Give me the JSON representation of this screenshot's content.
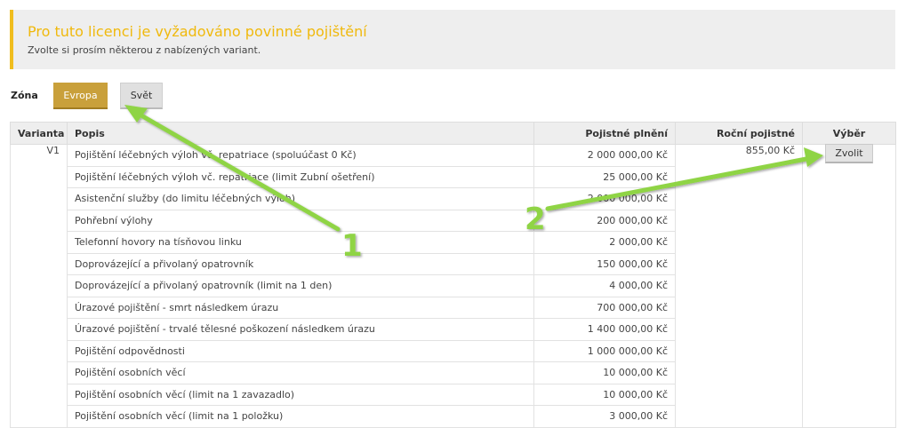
{
  "notice": {
    "title": "Pro tuto licenci je vyžadováno povinné pojištění",
    "text": "Zvolte si prosím některou z nabízených variant."
  },
  "zone": {
    "label": "Zóna",
    "options": [
      {
        "label": "Evropa",
        "active": true
      },
      {
        "label": "Svět",
        "active": false
      }
    ]
  },
  "table": {
    "headers": {
      "variant": "Varianta",
      "description": "Popis",
      "coverage": "Pojistné plnění",
      "premium": "Roční pojistné",
      "select": "Výběr"
    },
    "variant": "V1",
    "premium": "855,00 Kč",
    "select_label": "Zvolit",
    "rows": [
      {
        "desc": "Pojištění léčebných výloh vč. repatriace (spoluúčast 0 Kč)",
        "amount": "2 000 000,00 Kč"
      },
      {
        "desc": "Pojištění léčebných výloh vč. repatriace (limit Zubní ošetření)",
        "amount": "25 000,00 Kč"
      },
      {
        "desc": "Asistenční služby (do limitu léčebných výloh)",
        "amount": "2 000 000,00 Kč"
      },
      {
        "desc": "Pohřební výlohy",
        "amount": "200 000,00 Kč"
      },
      {
        "desc": "Telefonní hovory na tísňovou linku",
        "amount": "2 000,00 Kč"
      },
      {
        "desc": "Doprovázející a přivolaný opatrovník",
        "amount": "150 000,00 Kč"
      },
      {
        "desc": "Doprovázející a přivolaný opatrovník (limit na 1 den)",
        "amount": "4 000,00 Kč"
      },
      {
        "desc": "Úrazové pojištění - smrt následkem úrazu",
        "amount": "700 000,00 Kč"
      },
      {
        "desc": "Úrazové pojištění - trvalé tělesné poškození následkem úrazu",
        "amount": "1 400 000,00 Kč"
      },
      {
        "desc": "Pojištění odpovědnosti",
        "amount": "1 000 000,00 Kč"
      },
      {
        "desc": "Pojištění osobních věcí",
        "amount": "10 000,00 Kč"
      },
      {
        "desc": "Pojištění osobních věcí (limit na 1 zavazadlo)",
        "amount": "10 000,00 Kč"
      },
      {
        "desc": "Pojištění osobních věcí (limit na 1 položku)",
        "amount": "3 000,00 Kč"
      }
    ]
  },
  "annotations": {
    "marker_1": "1",
    "marker_2": "2",
    "arrow_color": "#8fd444",
    "marker_color": "#8fd444"
  }
}
